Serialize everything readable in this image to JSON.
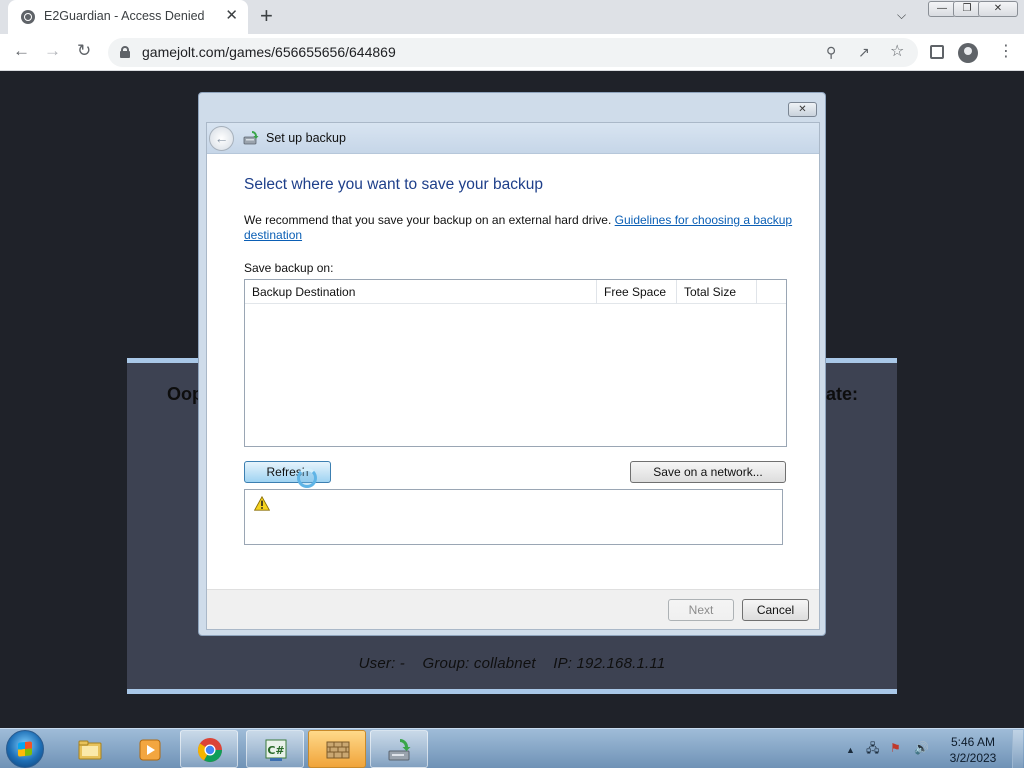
{
  "browser": {
    "tab_title": "E2Guardian - Access Denied",
    "tab_close": "✕",
    "new_tab": "+",
    "url": "gamejolt.com/games/656655656/644869",
    "window_minimize": "—",
    "window_restore": "❐",
    "window_close": "✕"
  },
  "background_page": {
    "heading_left": "Oop",
    "heading_right": "ate:",
    "user_line": "User: -    Group: collabnet    IP: 192.168.1.11"
  },
  "dialog": {
    "close_glyph": "✕",
    "header_title": "Set up backup",
    "heading": "Select where you want to save your backup",
    "recommend_text": "We recommend that you save your backup on an external hard drive. ",
    "guidelines_link": "Guidelines for choosing a backup destination",
    "save_on_label": "Save backup on:",
    "columns": [
      "Backup Destination",
      "Free Space",
      "Total Size"
    ],
    "refresh_button": "Refresh",
    "save_network_button": "Save on a network...",
    "next_button": "Next",
    "cancel_button": "Cancel"
  },
  "taskbar": {
    "time": "5:46 AM",
    "date": "3/2/2023",
    "items": [
      "windows-explorer",
      "media-player",
      "chrome",
      "csharp-editor",
      "firewall",
      "backup-restore"
    ]
  }
}
